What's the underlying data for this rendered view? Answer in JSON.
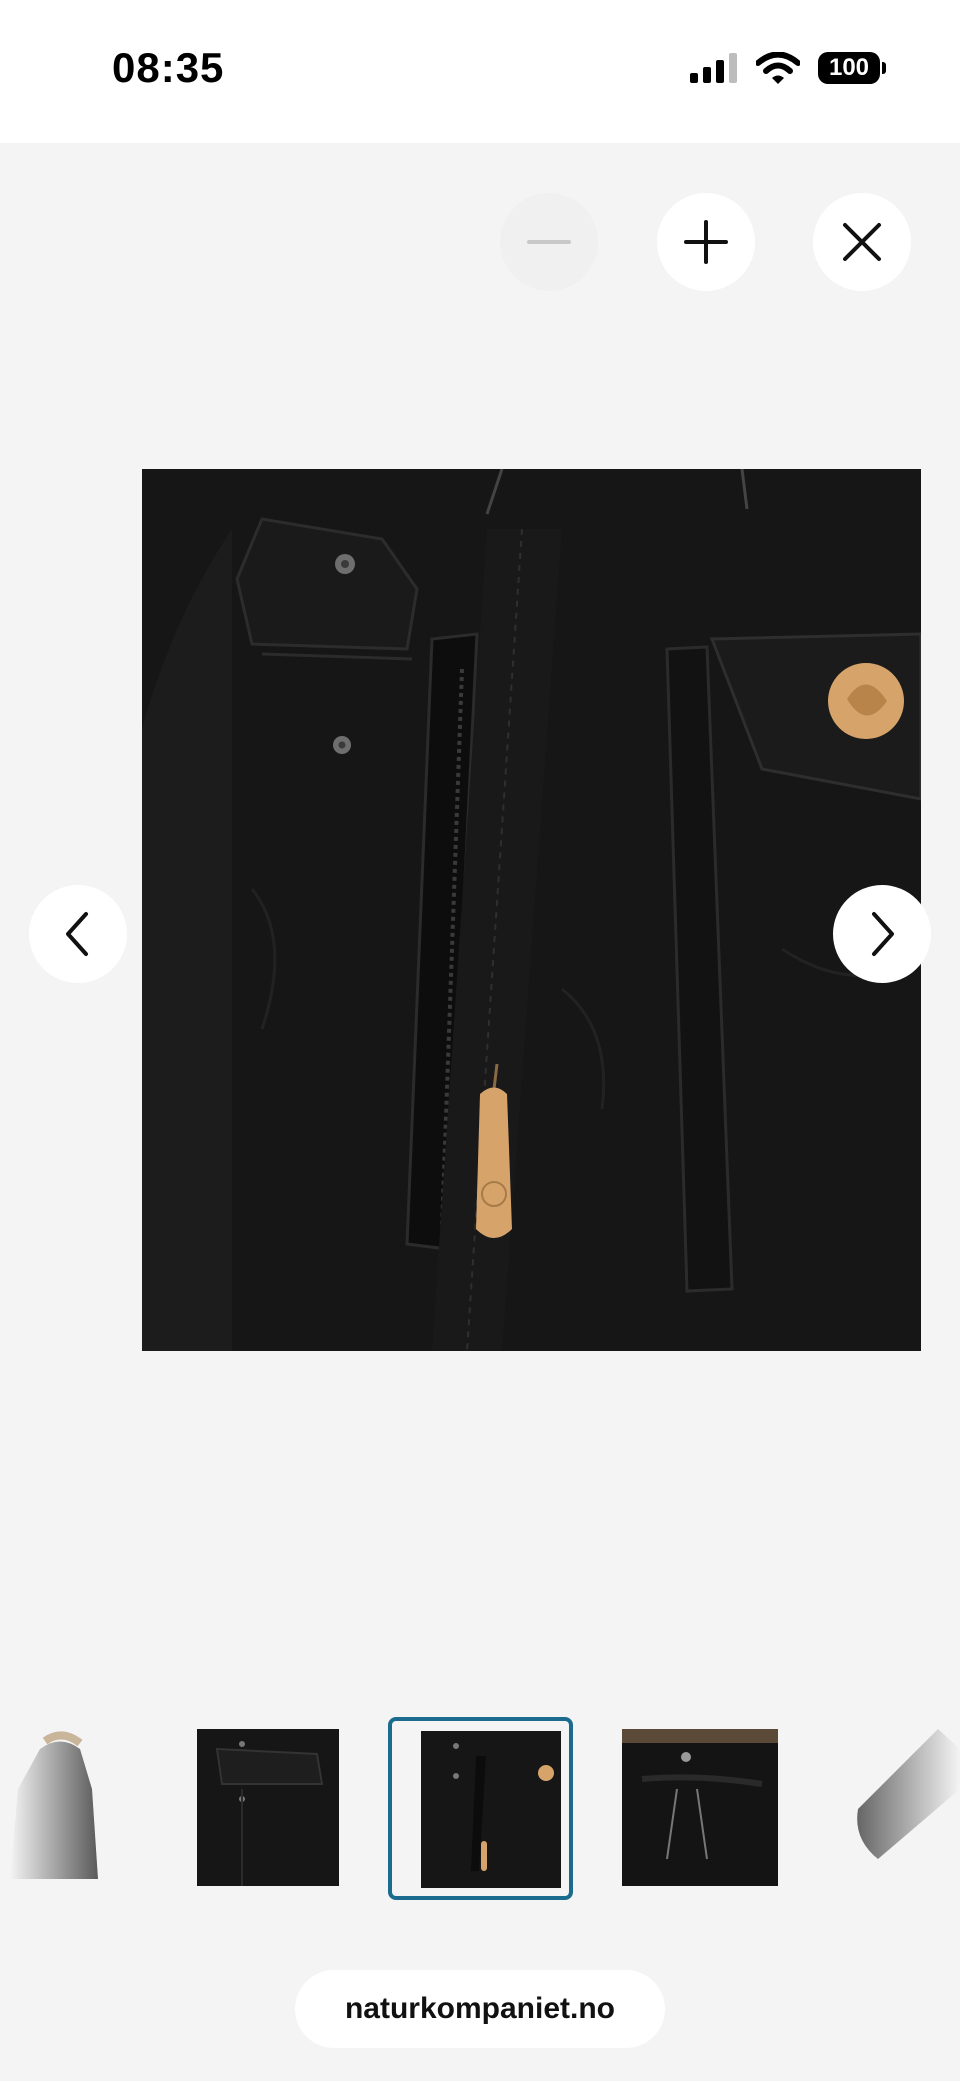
{
  "status_bar": {
    "time": "08:35",
    "battery": "100",
    "icons": [
      "cellular-signal-icon",
      "wifi-icon",
      "battery-icon"
    ]
  },
  "viewer": {
    "controls": [
      {
        "name": "zoom-out",
        "icon": "minus-icon",
        "enabled": false
      },
      {
        "name": "zoom-in",
        "icon": "plus-icon",
        "enabled": true
      },
      {
        "name": "close",
        "icon": "close-icon",
        "enabled": true
      }
    ],
    "nav": {
      "prev_icon": "chevron-left-icon",
      "next_icon": "chevron-right-icon"
    },
    "current_image": "jacket-front-detail-zipper-pocket",
    "thumbnails": [
      {
        "subject": "parka-full-grey",
        "selected": false
      },
      {
        "subject": "jacket-chest-pocket",
        "selected": false
      },
      {
        "subject": "jacket-front-zipper-detail",
        "selected": true
      },
      {
        "subject": "jacket-hood-drawcord",
        "selected": false
      },
      {
        "subject": "jacket-sleeve",
        "selected": false
      }
    ]
  },
  "browser": {
    "url": "naturkompaniet.no"
  },
  "colors": {
    "background": "#f4f4f4",
    "selection_border": "#1a6b8e",
    "jacket": "#141414",
    "leather_tag": "#d6a46a"
  }
}
